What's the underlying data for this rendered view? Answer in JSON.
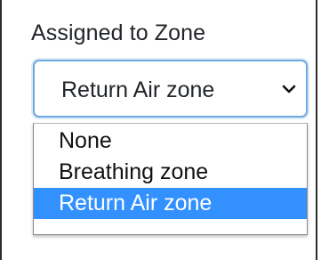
{
  "field": {
    "label": "Assigned to Zone"
  },
  "select": {
    "current_value": "Return Air zone",
    "chevron_icon": "chevron-down-icon"
  },
  "dropdown": {
    "options": [
      {
        "label": "None",
        "selected": false
      },
      {
        "label": "Breathing zone",
        "selected": false
      },
      {
        "label": "Return Air zone",
        "selected": true
      }
    ],
    "selected_color": "#3390ff"
  }
}
